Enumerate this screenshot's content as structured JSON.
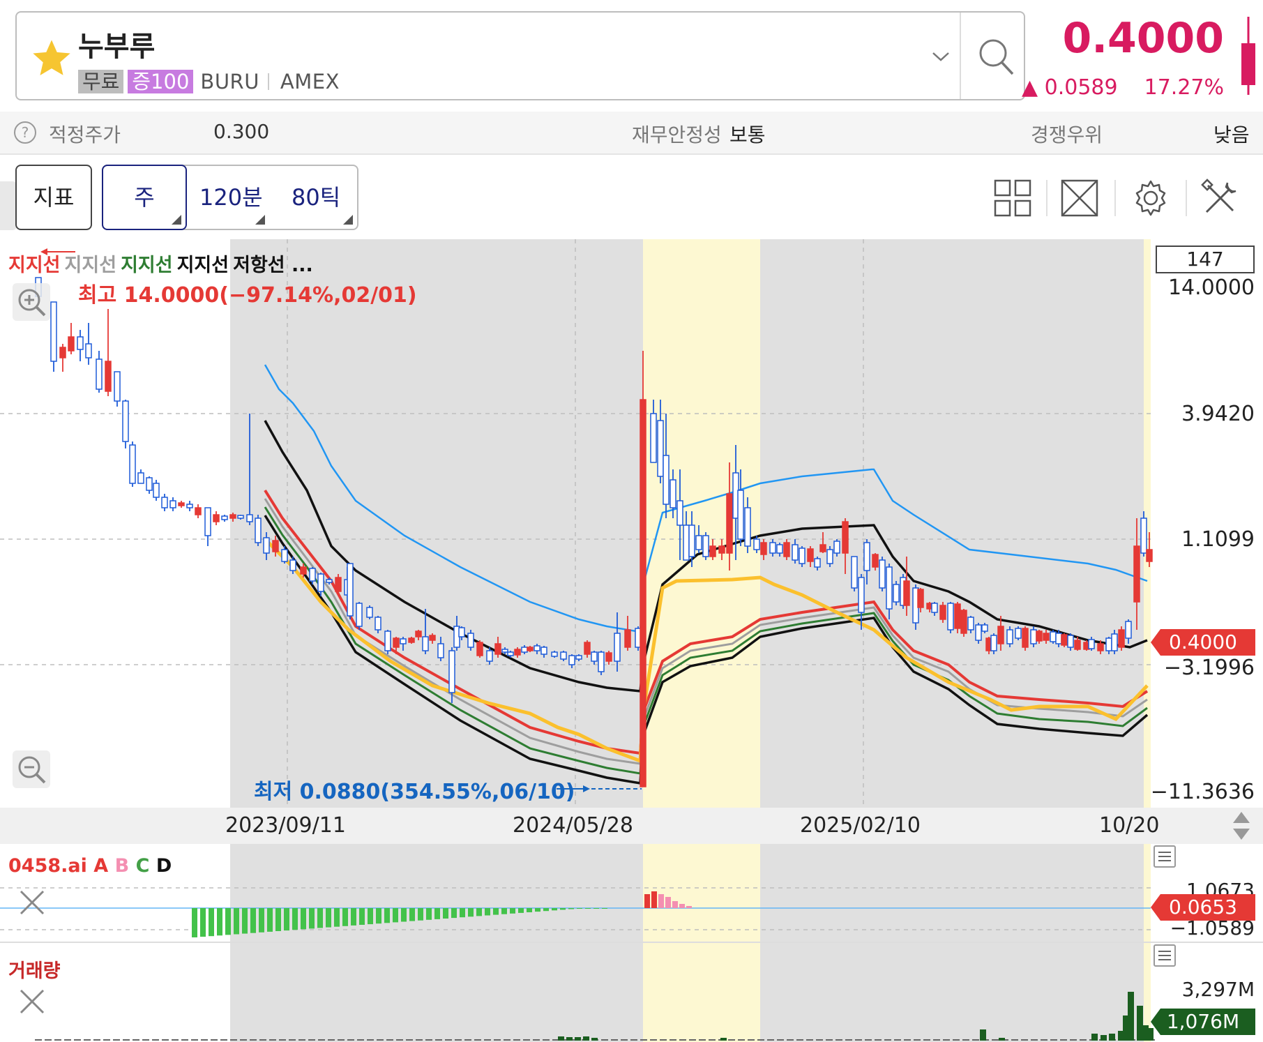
{
  "header": {
    "stock_name": "누부루",
    "tag_free": "무료",
    "tag_margin": "증100",
    "ticker": "BURU",
    "exchange": "AMEX",
    "price": "0.4000",
    "change": "▲ 0.0589",
    "change_pct": "17.27%",
    "accent_color": "#d81b60"
  },
  "info_row": {
    "fair_price_label": "적정주가",
    "fair_price_value": "0.300",
    "stability_label": "재무안정성",
    "stability_value": "보통",
    "competitive_label": "경쟁우위",
    "competitive_value": "낮음"
  },
  "toolbar": {
    "indicator_label": "지표",
    "periods": [
      "주",
      "120분",
      "80틱"
    ],
    "icons": [
      "grid-layout-icon",
      "fullscreen-icon",
      "settings-icon",
      "tools-icon"
    ]
  },
  "chart": {
    "legend": [
      {
        "text": "지지선",
        "color": "#e53935"
      },
      {
        "text": "지지선",
        "color": "#9e9e9e"
      },
      {
        "text": "지지선",
        "color": "#2e7d32"
      },
      {
        "text": "지지선",
        "color": "#111111"
      },
      {
        "text": "저항선 ...",
        "color": "#111111"
      }
    ],
    "max_label": "최고 14.0000(−97.14%,02/01)",
    "min_label": "최저 0.0880(354.55%,06/10)",
    "axis_box": "147",
    "y_ticks": [
      "14.0000",
      "3.9420",
      "1.1099",
      "−3.1996",
      "−11.3636"
    ],
    "current_tag": "0.4000",
    "dates": [
      "2023/09/11",
      "2024/05/28",
      "2025/02/10",
      "10/20"
    ]
  },
  "chart_data": {
    "type": "candlestick",
    "y_ticks": [
      "14.0000",
      "3.9420",
      "1.1099",
      "−3.1996",
      "−11.3636"
    ],
    "x_ticks": [
      "2023/09/11",
      "2024/05/28",
      "2025/02/10",
      "10/20"
    ],
    "last": 0.4,
    "high": 14.0,
    "low": 0.088
  },
  "sub1": {
    "legend_name": "0458.ai",
    "legend_a": "A",
    "legend_b": "B",
    "legend_c": "C",
    "legend_d": "D",
    "axis_top": "1.0673",
    "axis_bottom": "−1.0589",
    "tag": "0.0653"
  },
  "sub2": {
    "legend_name": "거래량",
    "axis_top": "3,297M",
    "tag": "1,076M"
  }
}
